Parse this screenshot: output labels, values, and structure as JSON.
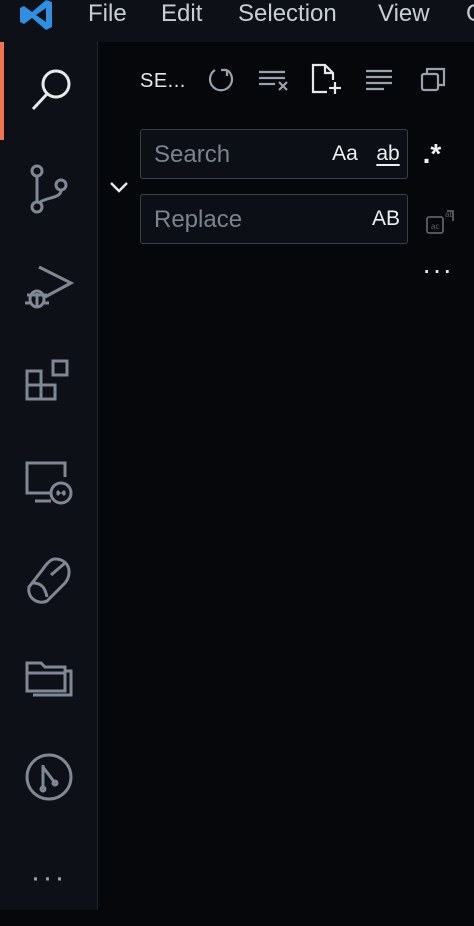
{
  "menu": {
    "items": [
      "File",
      "Edit",
      "Selection",
      "View",
      "G"
    ]
  },
  "activity_bar": {
    "items": [
      {
        "name": "search-icon",
        "active": true
      },
      {
        "name": "source-control-icon"
      },
      {
        "name": "run-debug-icon"
      },
      {
        "name": "extensions-icon"
      },
      {
        "name": "remote-explorer-icon"
      },
      {
        "name": "testing-icon"
      },
      {
        "name": "explorer-icon"
      },
      {
        "name": "git-graph-icon"
      }
    ],
    "more": "···"
  },
  "search_panel": {
    "title": "SE...",
    "toolbar": [
      "refresh-icon",
      "clear-results-icon",
      "new-search-editor-icon",
      "collapse-all-icon",
      "view-as-tree-icon"
    ],
    "search": {
      "placeholder": "Search",
      "value": "",
      "match_case": "Aa",
      "whole_word": "ab",
      "regex": ".*"
    },
    "replace": {
      "placeholder": "Replace",
      "value": "",
      "preserve_case": "AB"
    },
    "more": "···"
  },
  "colors": {
    "accent": "#f0744e",
    "vscode_blue": "#2f8fe0"
  }
}
